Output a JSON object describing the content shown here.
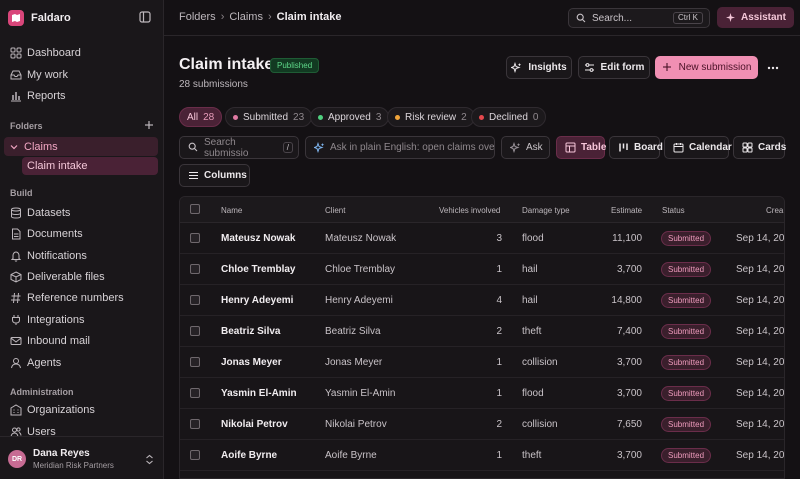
{
  "app": {
    "name": "Faldaro"
  },
  "sidebar": {
    "items": [
      {
        "label": "Dashboard",
        "icon": "dashboard-icon"
      },
      {
        "label": "My work",
        "icon": "inbox-icon"
      },
      {
        "label": "Reports",
        "icon": "bar-chart-icon"
      }
    ],
    "folders_label": "Folders",
    "folder": {
      "label": "Claims",
      "child": "Claim intake"
    },
    "build_label": "Build",
    "build_items": [
      {
        "label": "Datasets",
        "icon": "database-icon"
      },
      {
        "label": "Documents",
        "icon": "document-icon"
      },
      {
        "label": "Notifications",
        "icon": "bell-icon"
      },
      {
        "label": "Deliverable files",
        "icon": "package-icon"
      },
      {
        "label": "Reference numbers",
        "icon": "hash-icon"
      },
      {
        "label": "Integrations",
        "icon": "plug-icon"
      },
      {
        "label": "Inbound mail",
        "icon": "mail-icon"
      },
      {
        "label": "Agents",
        "icon": "agent-icon"
      }
    ],
    "admin_label": "Administration",
    "admin_items": [
      {
        "label": "Organizations",
        "icon": "organization-icon"
      },
      {
        "label": "Users",
        "icon": "users-icon"
      }
    ],
    "user": {
      "initials": "DR",
      "name": "Dana Reyes",
      "org": "Meridian Risk Partners"
    }
  },
  "topbar": {
    "breadcrumb": [
      "Folders",
      "Claims",
      "Claim intake"
    ],
    "search_placeholder": "Search...",
    "search_shortcut": "Ctrl K",
    "assistant_label": "Assistant"
  },
  "header": {
    "title": "Claim intake",
    "badge": "Published",
    "subtitle": "28 submissions",
    "insights_label": "Insights",
    "edit_label": "Edit form",
    "new_label": "New submission"
  },
  "status_tabs": [
    {
      "label": "All",
      "count": "28",
      "dot": ""
    },
    {
      "label": "Submitted",
      "count": "23",
      "dot": "#e07aa3"
    },
    {
      "label": "Approved",
      "count": "3",
      "dot": "#4fd07f"
    },
    {
      "label": "Risk review",
      "count": "2",
      "dot": "#f0a43a"
    },
    {
      "label": "Declined",
      "count": "0",
      "dot": "#e5484d"
    }
  ],
  "toolbar": {
    "search_placeholder": "Search submissio",
    "search_key": "/",
    "ask_placeholder": "Ask in plain English: open claims over",
    "ask_label": "Ask",
    "views": [
      "Table",
      "Board",
      "Calendar",
      "Cards"
    ],
    "columns_label": "Columns"
  },
  "table": {
    "headers": [
      "Name",
      "Client",
      "Vehicles involved",
      "Damage type",
      "Estimate",
      "Status",
      "Crea"
    ],
    "rows": [
      {
        "name": "Mateusz Nowak",
        "client": "Mateusz Nowak",
        "vehicles": "3",
        "damage": "flood",
        "estimate": "11,100",
        "status": "Submitted",
        "created": "Sep 14, 20"
      },
      {
        "name": "Chloe Tremblay",
        "client": "Chloe Tremblay",
        "vehicles": "1",
        "damage": "hail",
        "estimate": "3,700",
        "status": "Submitted",
        "created": "Sep 14, 20"
      },
      {
        "name": "Henry Adeyemi",
        "client": "Henry Adeyemi",
        "vehicles": "4",
        "damage": "hail",
        "estimate": "14,800",
        "status": "Submitted",
        "created": "Sep 14, 20"
      },
      {
        "name": "Beatriz Silva",
        "client": "Beatriz Silva",
        "vehicles": "2",
        "damage": "theft",
        "estimate": "7,400",
        "status": "Submitted",
        "created": "Sep 14, 20"
      },
      {
        "name": "Jonas Meyer",
        "client": "Jonas Meyer",
        "vehicles": "1",
        "damage": "collision",
        "estimate": "3,700",
        "status": "Submitted",
        "created": "Sep 14, 20"
      },
      {
        "name": "Yasmin El-Amin",
        "client": "Yasmin El-Amin",
        "vehicles": "1",
        "damage": "flood",
        "estimate": "3,700",
        "status": "Submitted",
        "created": "Sep 14, 20"
      },
      {
        "name": "Nikolai Petrov",
        "client": "Nikolai Petrov",
        "vehicles": "2",
        "damage": "collision",
        "estimate": "7,650",
        "status": "Submitted",
        "created": "Sep 14, 20"
      },
      {
        "name": "Aoife Byrne",
        "client": "Aoife Byrne",
        "vehicles": "1",
        "damage": "theft",
        "estimate": "3,700",
        "status": "Submitted",
        "created": "Sep 14, 20"
      }
    ]
  },
  "colors": {
    "accent": "#f08fb3",
    "accent_dark": "#4a2236",
    "background": "#141114",
    "success": "#5fd98a"
  }
}
